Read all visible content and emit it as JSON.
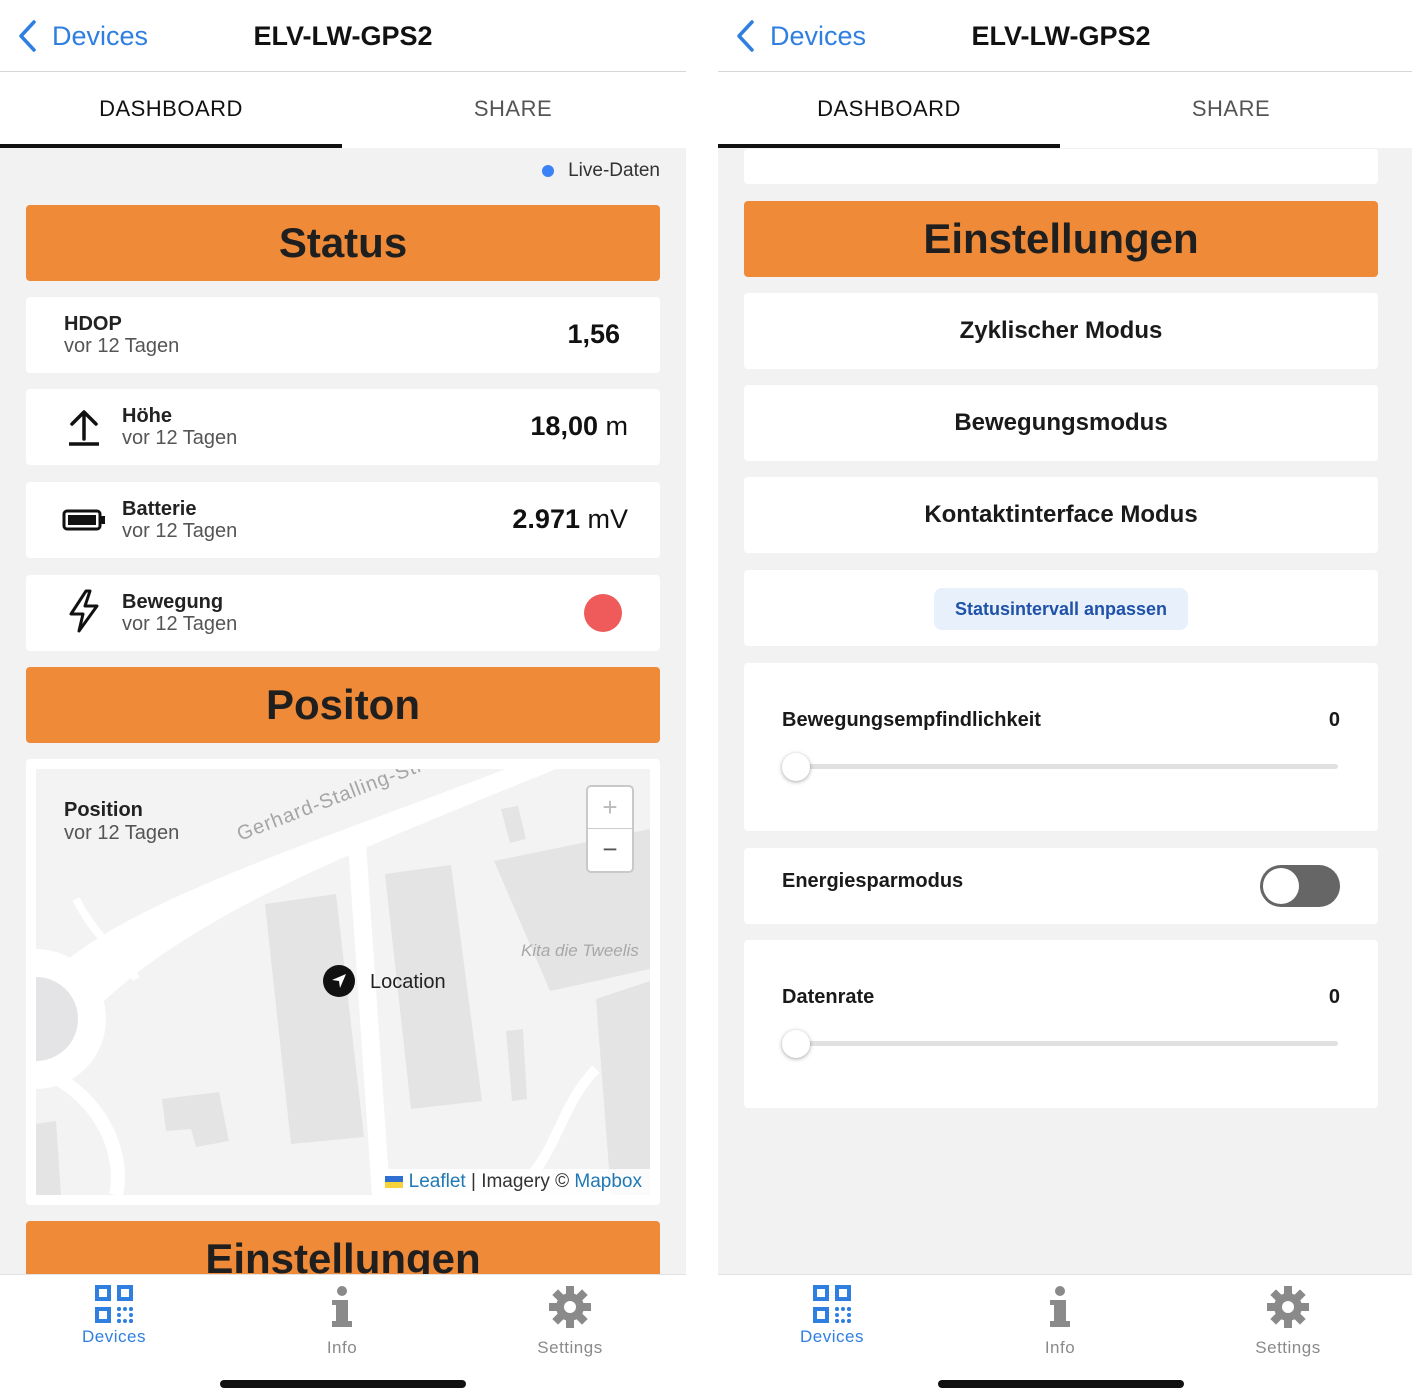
{
  "left": {
    "nav": {
      "back_label": "Devices",
      "title": "ELV-LW-GPS2"
    },
    "tabs": [
      "DASHBOARD",
      "SHARE"
    ],
    "live_label": "Live-Daten",
    "status_header": "Status",
    "rows": [
      {
        "title": "HDOP",
        "sub": "vor 12 Tagen",
        "value": "1,56",
        "unit": ""
      },
      {
        "title": "Höhe",
        "sub": "vor 12 Tagen",
        "value": "18,00",
        "unit": "m"
      },
      {
        "title": "Batterie",
        "sub": "vor 12 Tagen",
        "value": "2.971",
        "unit": "mV"
      },
      {
        "title": "Bewegung",
        "sub": "vor 12 Tagen",
        "status_color": "#ef5a5a"
      }
    ],
    "position_header": "Positon",
    "map": {
      "title": "Position",
      "sub": "vor 12 Tagen",
      "zoom_in": "+",
      "zoom_out": "−",
      "street_label": "Gerhard-Stalling-Straße",
      "poi_label": "Kita die Tweelis",
      "location_label": "Location",
      "attrib_leaflet": "Leaflet",
      "attrib_sep": "|",
      "attrib_imagery": "Imagery ©",
      "attrib_mapbox": "Mapbox"
    },
    "settings_header": "Einstellungen",
    "bottom_nav": [
      "Devices",
      "Info",
      "Settings"
    ]
  },
  "right": {
    "nav": {
      "back_label": "Devices",
      "title": "ELV-LW-GPS2"
    },
    "tabs": [
      "DASHBOARD",
      "SHARE"
    ],
    "settings_header": "Einstellungen",
    "mode_buttons": [
      "Zyklischer Modus",
      "Bewegungsmodus",
      "Kontaktinterface Modus"
    ],
    "chip_label": "Statusintervall anpassen",
    "sensitivity": {
      "label": "Bewegungsempfindlichkeit",
      "value": "0"
    },
    "power_save": {
      "label": "Energiesparmodus",
      "on": false
    },
    "datarate": {
      "label": "Datenrate",
      "value": "0"
    },
    "bottom_nav": [
      "Devices",
      "Info",
      "Settings"
    ]
  },
  "colors": {
    "accent": "#ee8a38",
    "link": "#2f7fe0",
    "live": "#3b82f6"
  }
}
